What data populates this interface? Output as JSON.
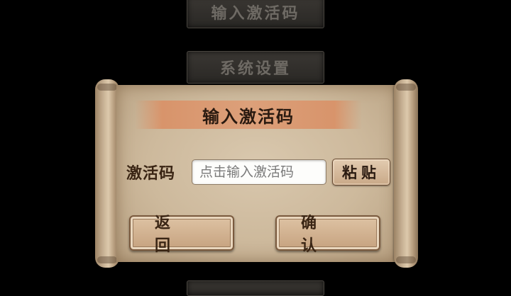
{
  "background_menu": {
    "activate_code_label": "输入激活码",
    "system_settings_label": "系统设置"
  },
  "dialog": {
    "title": "输入激活码",
    "field_label": "激活码",
    "input_placeholder": "点击输入激活码",
    "input_value": "",
    "paste_label": "粘贴",
    "back_label": "返回",
    "confirm_label": "确认"
  },
  "colors": {
    "background": "#000000",
    "paper": "#cdb99c",
    "title_band": "#dca07a",
    "text_dark": "#2a1a10"
  }
}
